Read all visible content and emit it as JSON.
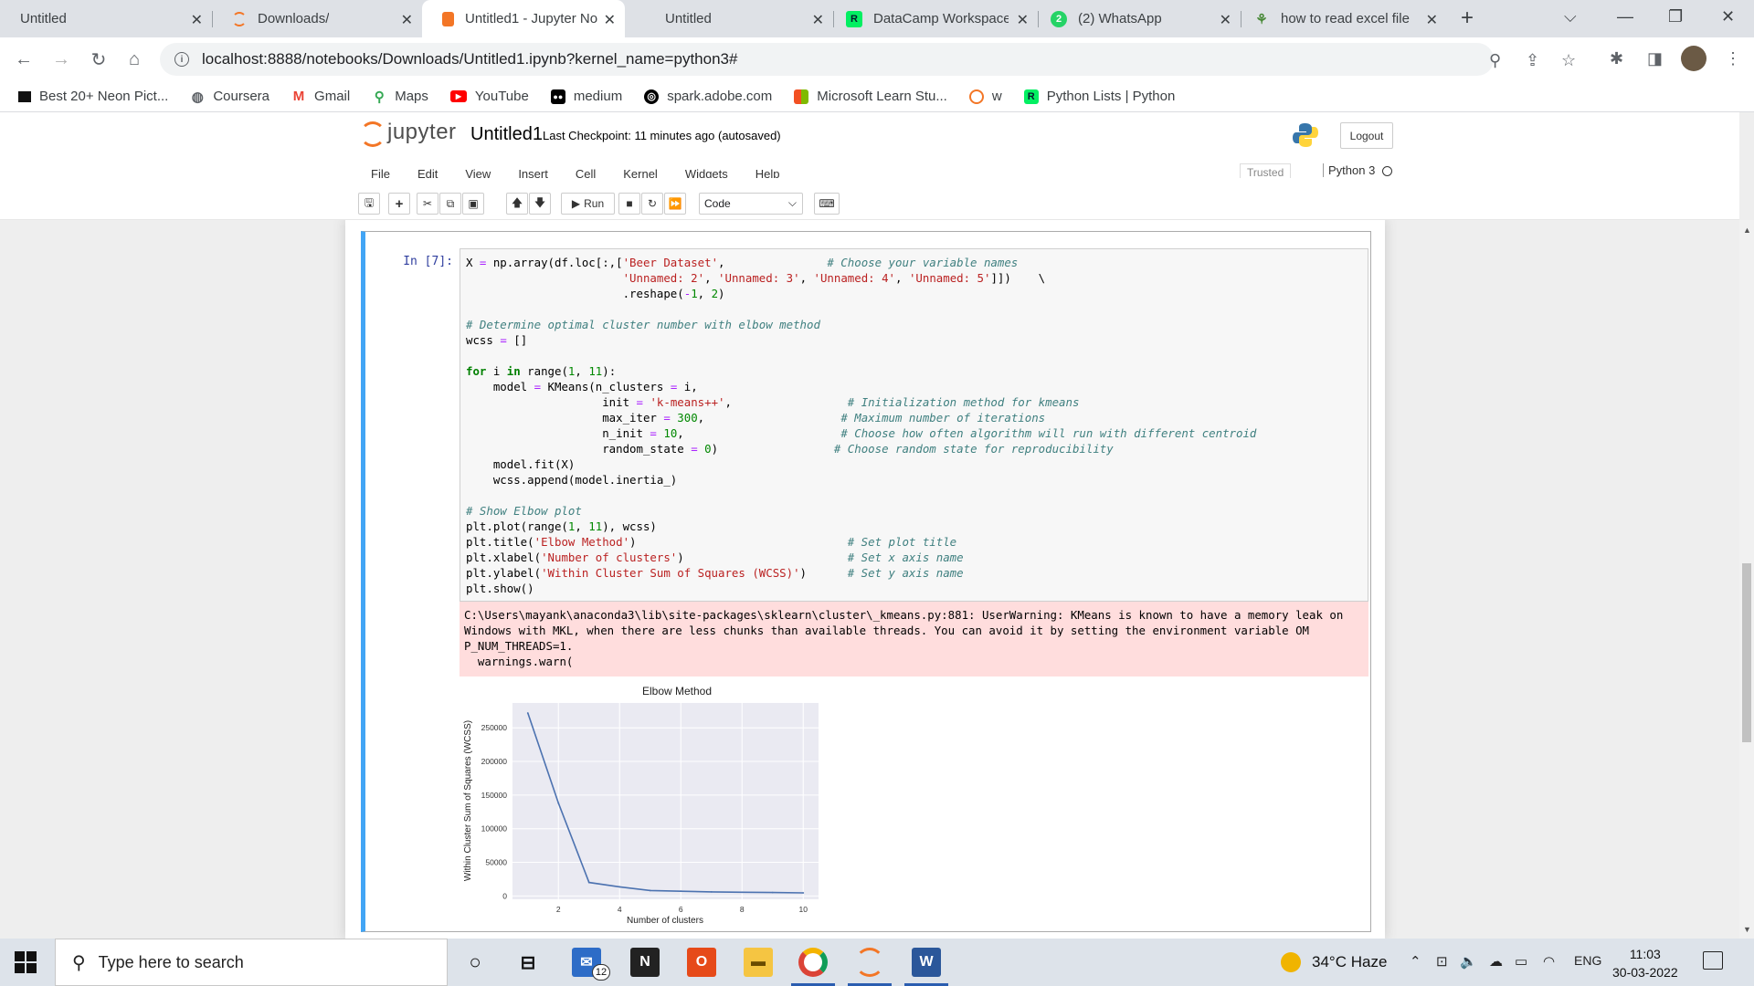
{
  "browser": {
    "tabs": [
      {
        "title": "Untitled",
        "icon": "blank-page-icon"
      },
      {
        "title": "Downloads/",
        "icon": "jupyter-icon"
      },
      {
        "title": "Untitled1 - Jupyter No",
        "icon": "jupyter-notebook-icon",
        "active": true
      },
      {
        "title": "Untitled",
        "icon": "blank-page-icon"
      },
      {
        "title": "DataCamp Workspace",
        "icon": "datacamp-icon"
      },
      {
        "title": "(2) WhatsApp",
        "icon": "whatsapp-icon"
      },
      {
        "title": "how to read excel file",
        "icon": "search-result-icon"
      }
    ],
    "new_tab": "+",
    "url": "localhost:8888/notebooks/Downloads/Untitled1.ipynb?kernel_name=python3#",
    "bookmarks": [
      {
        "label": "Best 20+ Neon Pict...",
        "icon": "unsplash-icon"
      },
      {
        "label": "Coursera",
        "icon": "globe-icon"
      },
      {
        "label": "Gmail",
        "icon": "gmail-icon"
      },
      {
        "label": "Maps",
        "icon": "maps-pin-icon"
      },
      {
        "label": "YouTube",
        "icon": "youtube-icon"
      },
      {
        "label": "medium",
        "icon": "medium-icon"
      },
      {
        "label": "spark.adobe.com",
        "icon": "adobe-spark-icon"
      },
      {
        "label": "Microsoft Learn Stu...",
        "icon": "microsoft-icon"
      },
      {
        "label": "w",
        "icon": "w-icon"
      },
      {
        "label": "Python Lists | Python",
        "icon": "datacamp-icon"
      }
    ]
  },
  "jupyter": {
    "brand": "jupyter",
    "notebook_name": "Untitled1",
    "checkpoint": "Last Checkpoint: 11 minutes ago  (autosaved)",
    "logout": "Logout",
    "menu": [
      "File",
      "Edit",
      "View",
      "Insert",
      "Cell",
      "Kernel",
      "Widgets",
      "Help"
    ],
    "trusted": "Trusted",
    "kernel": "Python 3",
    "run_label": "Run",
    "cell_type": "Code"
  },
  "cell": {
    "prompt": "In [7]:",
    "stderr": "C:\\Users\\mayank\\anaconda3\\lib\\site-packages\\sklearn\\cluster\\_kmeans.py:881: UserWarning: KMeans is known to have a memory leak on Windows with MKL, when there are less chunks than available threads. You can avoid it by setting the environment variable OM P_NUM_THREADS=1.\n  warnings.warn("
  },
  "chart_data": {
    "type": "line",
    "title": "Elbow Method",
    "xlabel": "Number of clusters",
    "ylabel": "Within Cluster Sum of Squares (WCSS)",
    "x": [
      1,
      2,
      3,
      4,
      5,
      6,
      7,
      8,
      9,
      10
    ],
    "values": [
      272000,
      138000,
      20000,
      13500,
      8000,
      7000,
      6000,
      5500,
      5000,
      4500
    ],
    "xlim": [
      0.5,
      10.5
    ],
    "ylim": [
      -5000,
      287000
    ],
    "xticks": [
      "2",
      "4",
      "6",
      "8",
      "10"
    ],
    "yticks": [
      "0",
      "50000",
      "100000",
      "150000",
      "200000",
      "250000"
    ],
    "grid": true,
    "line_color": "#4c72b0",
    "background": "#eaeaf2"
  },
  "taskbar": {
    "search_placeholder": "Type here to search",
    "mail_badge": "12",
    "weather": "34°C  Haze",
    "lang": "ENG",
    "time": "11:03",
    "date": "30-03-2022"
  }
}
